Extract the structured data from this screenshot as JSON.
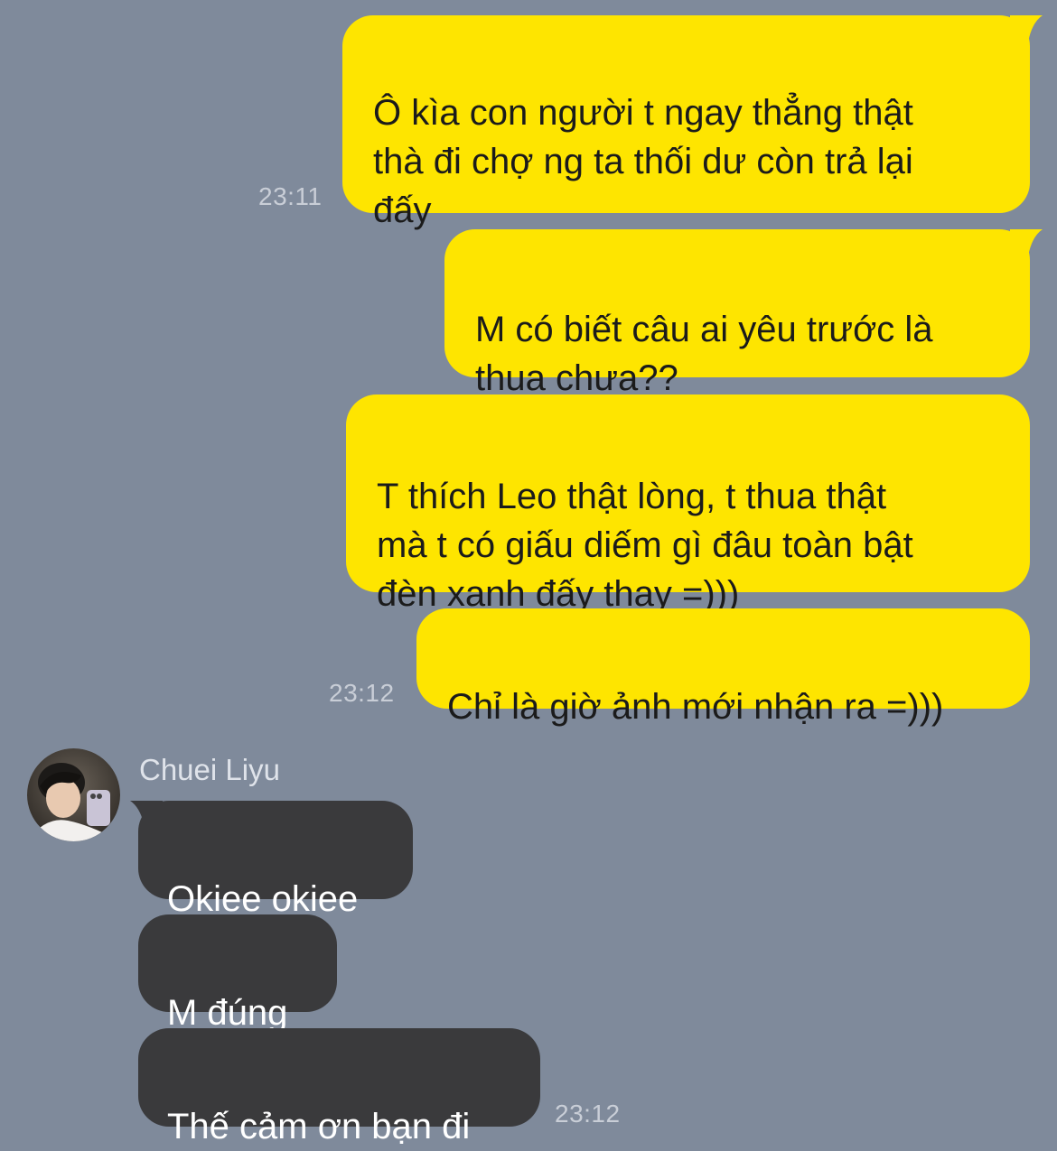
{
  "outgoing": [
    {
      "text": "Ô kìa con người t ngay thẳng thật\nthà đi chợ ng ta thối dư còn trả lại\nđấy"
    },
    {
      "text": "M có biết câu ai yêu trước là\nthua chưa??"
    },
    {
      "text": "T thích Leo thật lòng, t thua thật\nmà t có giấu diếm gì đâu toàn bật\nđèn xanh đấy thay =)))"
    },
    {
      "text": "Chỉ là giờ ảnh mới nhận ra =)))"
    }
  ],
  "incoming": {
    "sender": "Chuei Liyu",
    "messages": [
      {
        "text": "Okiee okiee"
      },
      {
        "text": "M đúng"
      },
      {
        "text": "Thế cảm ơn bạn đi"
      }
    ]
  },
  "timestamps": {
    "t1": "23:11",
    "t2": "23:12",
    "t3": "23:12"
  },
  "colors": {
    "background": "#7f8a9b",
    "outgoing_bubble": "#fee500",
    "incoming_bubble": "#3a3a3c",
    "timestamp": "#c9ced7"
  },
  "icons": {
    "avatar": "profile-photo"
  }
}
